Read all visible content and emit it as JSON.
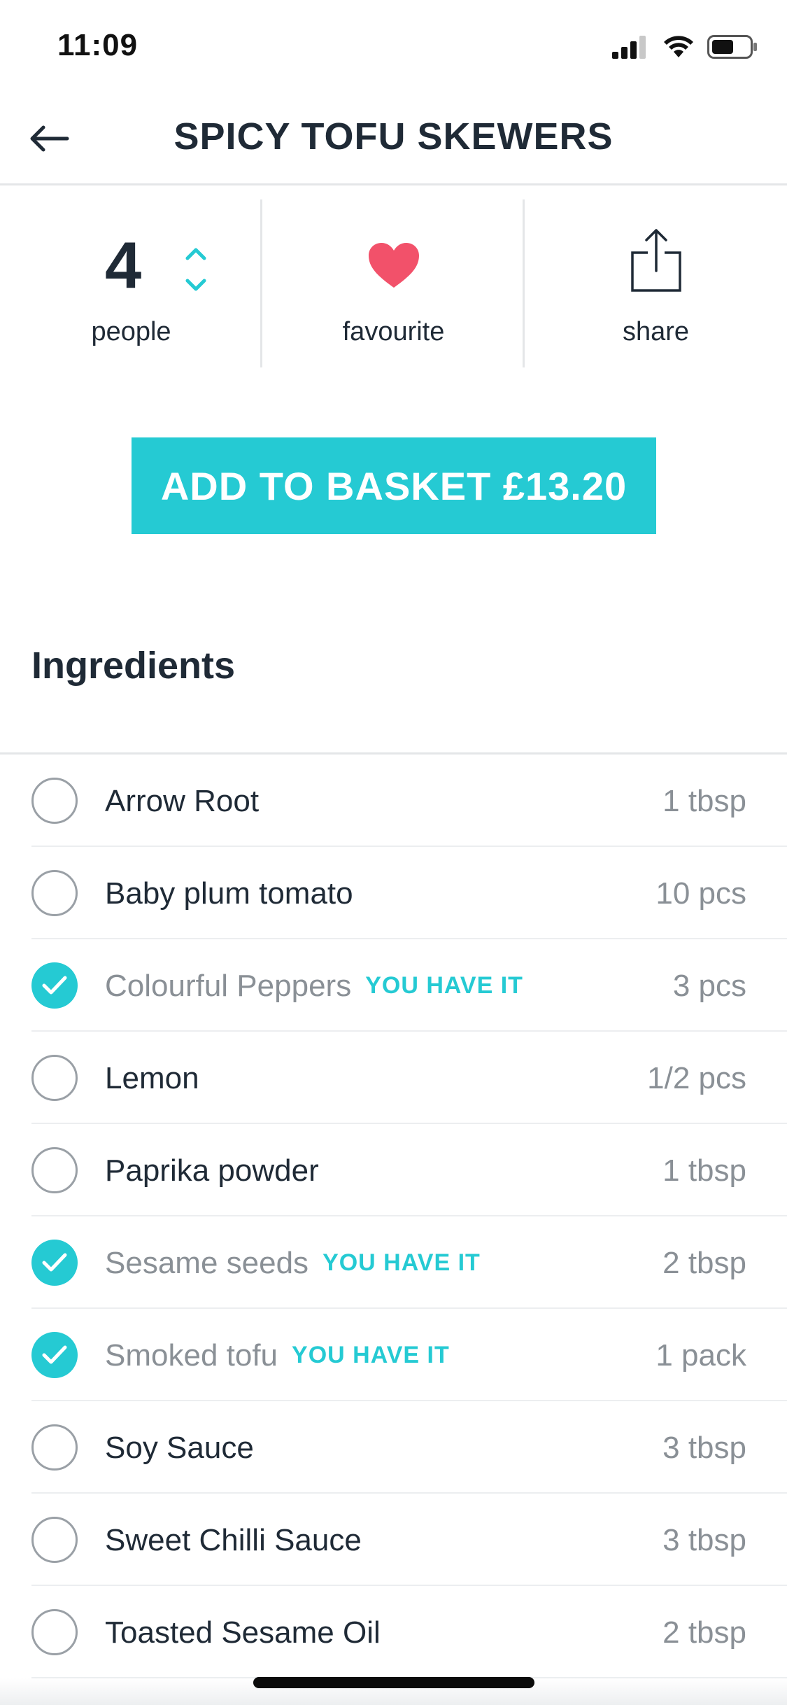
{
  "status_bar": {
    "time": "11:09"
  },
  "header": {
    "title": "SPICY TOFU SKEWERS"
  },
  "actions": {
    "people_count": "4",
    "people_label": "people",
    "favourite_label": "favourite",
    "share_label": "share"
  },
  "basket": {
    "label": "ADD TO BASKET £13.20"
  },
  "ingredients": {
    "title": "Ingredients",
    "have_label": "YOU HAVE IT",
    "items": [
      {
        "name": "Arrow Root",
        "qty": "1 tbsp",
        "have": false
      },
      {
        "name": "Baby plum tomato",
        "qty": "10 pcs",
        "have": false
      },
      {
        "name": "Colourful Peppers",
        "qty": "3 pcs",
        "have": true
      },
      {
        "name": "Lemon",
        "qty": "1/2 pcs",
        "have": false
      },
      {
        "name": "Paprika powder",
        "qty": "1 tbsp",
        "have": false
      },
      {
        "name": "Sesame seeds",
        "qty": "2 tbsp",
        "have": true
      },
      {
        "name": "Smoked tofu",
        "qty": "1 pack",
        "have": true
      },
      {
        "name": "Soy Sauce",
        "qty": "3 tbsp",
        "have": false
      },
      {
        "name": "Sweet Chilli Sauce",
        "qty": "3 tbsp",
        "have": false
      },
      {
        "name": "Toasted Sesame Oil",
        "qty": "2 tbsp",
        "have": false
      }
    ]
  },
  "colors": {
    "accent": "#25cad3",
    "heart": "#f2516a",
    "text": "#1f2a36",
    "muted": "#8a9096"
  },
  "icons": {
    "back": "arrow-left-icon",
    "stepper": "chevron-up-down-icon",
    "favourite": "heart-icon",
    "share": "share-icon",
    "check": "check-icon"
  }
}
